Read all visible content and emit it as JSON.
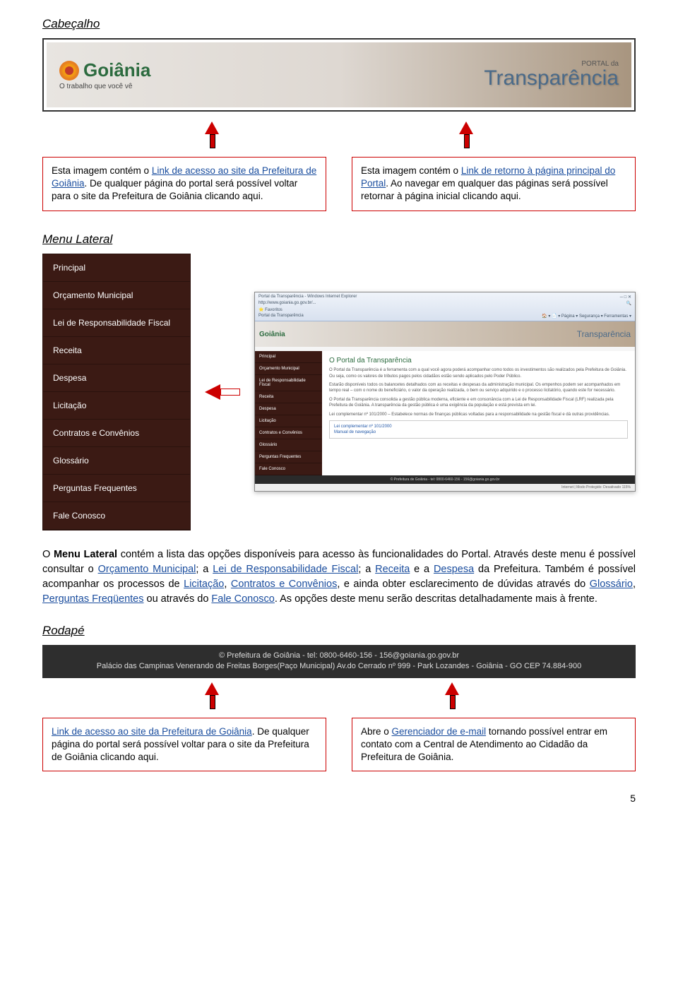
{
  "section_titles": {
    "cabecalho": "Cabeçalho",
    "menu_lateral": "Menu Lateral",
    "rodape": "Rodapé"
  },
  "header_banner": {
    "logo_text": "Goiânia",
    "logo_sub": "O trabalho que você vê",
    "portal_small": "PORTAL da",
    "transparencia": "Transparência"
  },
  "desc1_part1": "Esta imagem contém o ",
  "desc1_link1": "Link de acesso ao site da Prefeitura de Goiânia",
  "desc1_part2": ". De qualquer página do portal será possível voltar para o site da Prefeitura de Goiânia clicando aqui.",
  "desc2_part1": "Esta imagem contém o ",
  "desc2_link1": "Link de retorno à página principal do Portal",
  "desc2_part2": ". Ao navegar em qualquer das páginas será possível retornar à página inicial clicando aqui.",
  "sidemenu_items": [
    "Principal",
    "Orçamento Municipal",
    "Lei de Responsabilidade Fiscal",
    "Receita",
    "Despesa",
    "Licitação",
    "Contratos e Convênios",
    "Glossário",
    "Perguntas Frequentes",
    "Fale Conosco"
  ],
  "thumb": {
    "chrome_title": "Portal da Transparência - Windows Internet Explorer",
    "url": "http://www.goiania.go.gov.br/...",
    "tab": "Portal da Transparência",
    "heading": "O Portal da Transparência",
    "p1": "O Portal da Transparência é a ferramenta com a qual você agora poderá acompanhar como todos os investimentos são realizados pela Prefeitura de Goiânia. Ou seja, como os valores de tributos pagos pelos cidadãos estão sendo aplicados pelo Poder Público.",
    "p2": "Estarão disponíveis todos os balancetes detalhados com as receitas e despesas da administração municipal. Os empenhos podem ser acompanhados em tempo real – com o nome do beneficiário, o valor da operação realizada, o bem ou serviço adquirido e o processo licitatório, quando este for necessário.",
    "p3": "O Portal da Transparência consolida a gestão pública moderna, eficiente e em consonância com a Lei de Responsabilidade Fiscal (LRF) realizada pela Prefeitura de Goiânia. A transparência da gestão pública é uma exigência da população e está prevista em lei.",
    "p4": "Lei complementar nº 101/2000 – Estabelece normas de finanças públicas voltadas para a responsabilidade na gestão fiscal e dá outras providências.",
    "list1": "Lei complementar nº 101/2000",
    "list2": "Manual de navegação",
    "footer": "© Prefeitura de Goiânia - tel: 0800-6460-156 - 156@goiania.go.gov.br",
    "status": "Internet | Modo Protegido: Desativado      115%"
  },
  "para": {
    "t1": "O ",
    "b1": "Menu Lateral",
    "t2": " contém a lista das opções disponíveis para acesso às funcionalidades do Portal. Através deste menu é possível consultar o ",
    "l1": "Orçamento Municipal",
    "t3": "; a ",
    "l2": "Lei de Responsabilidade Fiscal",
    "t4": "; a ",
    "l3": "Receita",
    "t5": " e a ",
    "l4": "Despesa",
    "t6": " da Prefeitura. Também é possível acompanhar os processos de ",
    "l5": "Licitação",
    "t7": ", ",
    "l6": "Contratos e Convênios",
    "t8": ", e ainda obter esclarecimento de dúvidas através do ",
    "l7": "Glossário",
    "t9": ", ",
    "l8": "Perguntas Freqüentes",
    "t10": " ou através do ",
    "l9": "Fale Conosco",
    "t11": ". As opções deste menu serão descritas detalhadamente mais à frente."
  },
  "footer_bar": {
    "line1": "© Prefeitura de Goiânia - tel: 0800-6460-156 - 156@goiania.go.gov.br",
    "line2": "Palácio das Campinas Venerando de Freitas Borges(Paço Municipal) Av.do Cerrado nº 999 - Park Lozandes - Goiânia - GO CEP 74.884-900"
  },
  "desc3_link": "Link de acesso ao site da Prefeitura de Goiânia",
  "desc3_text": ". De qualquer página do portal será possível voltar para o site da Prefeitura de Goiânia clicando aqui.",
  "desc4_part1": "Abre o ",
  "desc4_link": "Gerenciador de e-mail",
  "desc4_part2": " tornando possível entrar em contato com a Central de Atendimento ao Cidadão da Prefeitura de Goiânia.",
  "page_number": "5"
}
